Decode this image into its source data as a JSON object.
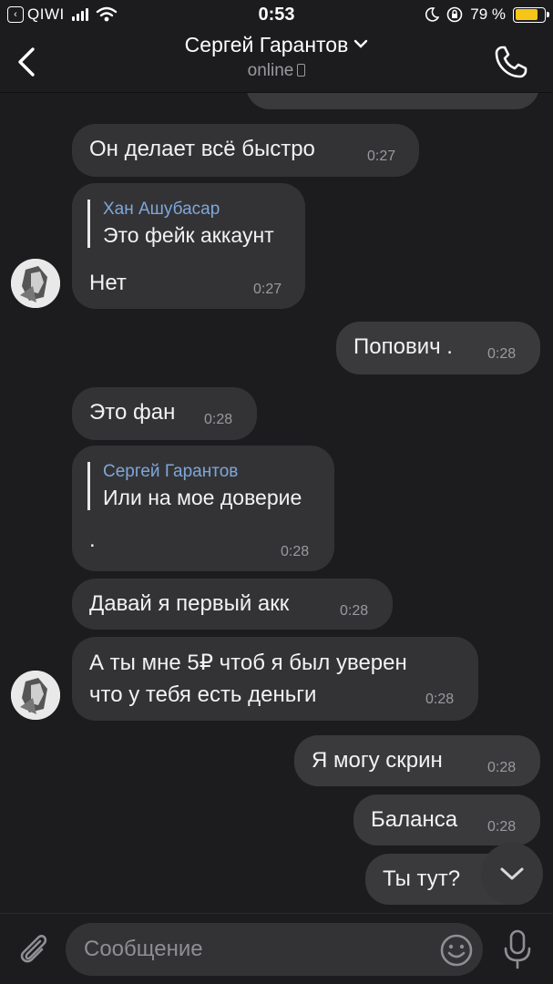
{
  "status_bar": {
    "back_app": "QIWI",
    "time": "0:53",
    "battery": "79 %",
    "battery_level": 0.79
  },
  "header": {
    "contact_name": "Сергей Гарантов",
    "status": "online"
  },
  "messages": [
    {
      "text": "Он делает всё быстро",
      "time": "0:27",
      "direction": "in"
    },
    {
      "reply_to": "Хан Ашубасар",
      "reply_text": "Это фейк аккаунт",
      "text": "Нет",
      "time": "0:27",
      "direction": "in"
    },
    {
      "text": "Попович .",
      "time": "0:28",
      "direction": "out"
    },
    {
      "text": "Это фан",
      "time": "0:28",
      "direction": "in"
    },
    {
      "reply_to": "Сергей Гарантов",
      "reply_text": "Или на мое доверие",
      "text": ".",
      "time": "0:28",
      "direction": "in"
    },
    {
      "text": "Давай я первый акк",
      "time": "0:28",
      "direction": "in"
    },
    {
      "text_line1": "А ты мне 5₽ чтоб я был уверен",
      "text_line2": "что у тебя есть деньги",
      "time": "0:28",
      "direction": "in"
    },
    {
      "text": "Я могу скрин",
      "time": "0:28",
      "direction": "out"
    },
    {
      "text": "Баланса",
      "time": "0:28",
      "direction": "out"
    },
    {
      "text": "Ты тут?",
      "direction": "out"
    }
  ],
  "composer": {
    "placeholder": "Сообщение"
  },
  "icons": [
    "back-chevron-icon",
    "phone-icon",
    "paperclip-icon",
    "emoji-icon",
    "microphone-icon",
    "chevron-down-icon",
    "wifi-icon",
    "signal-icon",
    "battery-icon"
  ],
  "colors": {
    "background": "#1c1c1e",
    "bubble": "#333336",
    "reply_name": "#7fa7d9",
    "battery": "#f6c518"
  }
}
